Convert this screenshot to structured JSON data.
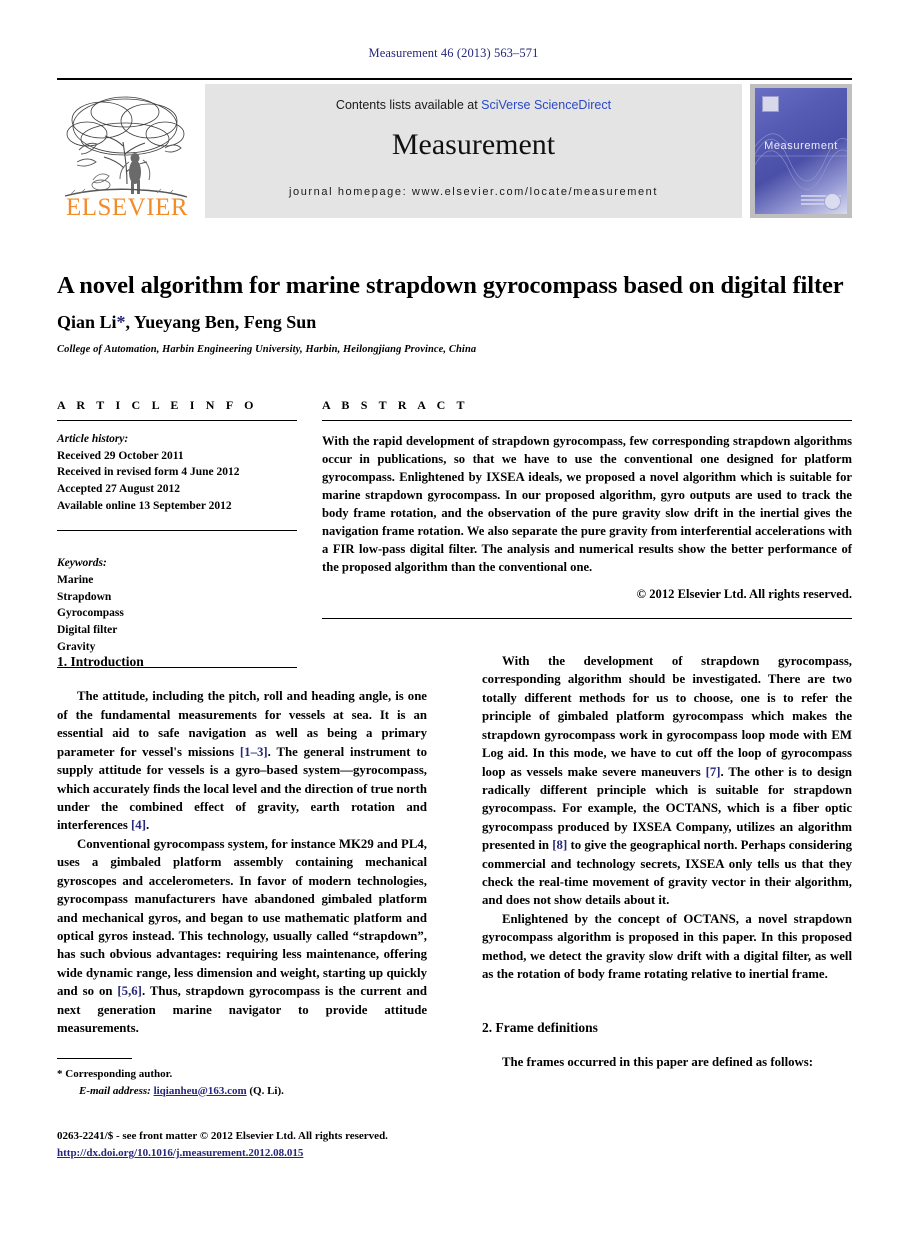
{
  "running_head": "Measurement 46 (2013) 563–571",
  "masthead": {
    "contents_prefix": "Contents lists available at ",
    "contents_link": "SciVerse ScienceDirect",
    "journal_name": "Measurement",
    "homepage": "journal homepage: www.elsevier.com/locate/measurement",
    "publisher_logo_label": "ELSEVIER",
    "cover_title": "Measurement",
    "link_color": "#2b49c6",
    "elsevier_orange": "#f28c28"
  },
  "article": {
    "title": "A novel algorithm for marine strapdown gyrocompass based on digital filter",
    "authors": "Qian Li",
    "corresponding_marker": "*",
    "authors_rest": ", Yueyang Ben, Feng Sun",
    "affiliation": "College of Automation, Harbin Engineering University, Harbin, Heilongjiang Province, China"
  },
  "info": {
    "heading": "A R T I C L E    I N F O",
    "history_heading": "Article history:",
    "history": [
      "Received 29 October 2011",
      "Received in revised form 4 June 2012",
      "Accepted 27 August 2012",
      "Available online 13 September 2012"
    ],
    "keywords_heading": "Keywords:",
    "keywords": [
      "Marine",
      "Strapdown",
      "Gyrocompass",
      "Digital filter",
      "Gravity"
    ]
  },
  "abstract": {
    "heading": "A B S T R A C T",
    "text": "With the rapid development of strapdown gyrocompass, few corresponding strapdown algorithms occur in publications, so that we have to use the conventional one designed for platform gyrocompass. Enlightened by IXSEA ideals, we proposed a novel algorithm which is suitable for marine strapdown gyrocompass. In our proposed algorithm, gyro outputs are used to track the body frame rotation, and the observation of the pure gravity slow drift in the inertial gives the navigation frame rotation. We also separate the pure gravity from interferential accelerations with a FIR low-pass digital filter. The analysis and numerical results show the better performance of the proposed algorithm than the conventional one.",
    "copyright": "© 2012 Elsevier Ltd. All rights reserved."
  },
  "sections": {
    "introduction_heading": "1. Introduction",
    "intro_p1_a": "The attitude, including the pitch, roll and heading angle, is one of the fundamental measurements for vessels at sea. It is an essential aid to safe navigation as well as being a primary parameter for vessel's missions ",
    "intro_p1_ref1": "[1–3]",
    "intro_p1_b": ". The general instrument to supply attitude for vessels is a gyro–based system—gyrocompass, which accurately finds the local level and the direction of true north under the combined effect of gravity, earth rotation and interferences ",
    "intro_p1_ref2": "[4]",
    "intro_p1_c": ".",
    "intro_p2_a": "Conventional gyrocompass system, for instance MK29 and PL4, uses a gimbaled platform assembly containing mechanical gyroscopes and accelerometers. In favor of modern technologies, gyrocompass manufacturers have abandoned gimbaled platform and mechanical gyros, and began to use mathematic platform and optical gyros instead. This technology, usually called “strapdown”, has such obvious advantages: requiring less maintenance, offering wide dynamic range, less dimension and weight, starting up quickly and so on ",
    "intro_p2_ref": "[5,6]",
    "intro_p2_b": ". Thus, strapdown gyrocompass is the current and next generation marine navigator to provide attitude measurements.",
    "intro_p3_a": "With the development of strapdown gyrocompass, corresponding algorithm should be investigated. There are two totally different methods for us to choose, one is to refer the principle of gimbaled platform gyrocompass which makes the strapdown gyrocompass work in gyrocompass loop mode with EM Log aid. In this mode, we have to cut off the loop of gyrocompass loop as vessels make severe maneuvers ",
    "intro_p3_ref1": "[7]",
    "intro_p3_b": ". The other is to design radically different principle which is suitable for strapdown gyrocompass. For example, the OCTANS, which is a fiber optic gyrocompass produced by IXSEA Company, utilizes an algorithm presented in ",
    "intro_p3_ref2": "[8]",
    "intro_p3_c": " to give the geographical north. Perhaps considering commercial and technology secrets, IXSEA only tells us that they check the real-time movement of gravity vector in their algorithm, and does not show details about it.",
    "intro_p4": "Enlightened by the concept of OCTANS, a novel strapdown gyrocompass algorithm is proposed in this paper. In this proposed method, we detect the gravity slow drift with a digital filter, as well as the rotation of body frame rotating relative to inertial frame.",
    "frames_heading": "2. Frame definitions",
    "frames_p1": "The frames occurred in this paper are defined as follows:"
  },
  "footnote": {
    "corresponding": "* Corresponding author.",
    "email_label": "E-mail address:",
    "email": "liqianheu@163.com",
    "email_owner": "(Q. Li)."
  },
  "bottom": {
    "issn_line": "0263-2241/$ - see front matter © 2012 Elsevier Ltd. All rights reserved.",
    "doi": "http://dx.doi.org/10.1016/j.measurement.2012.08.015"
  }
}
